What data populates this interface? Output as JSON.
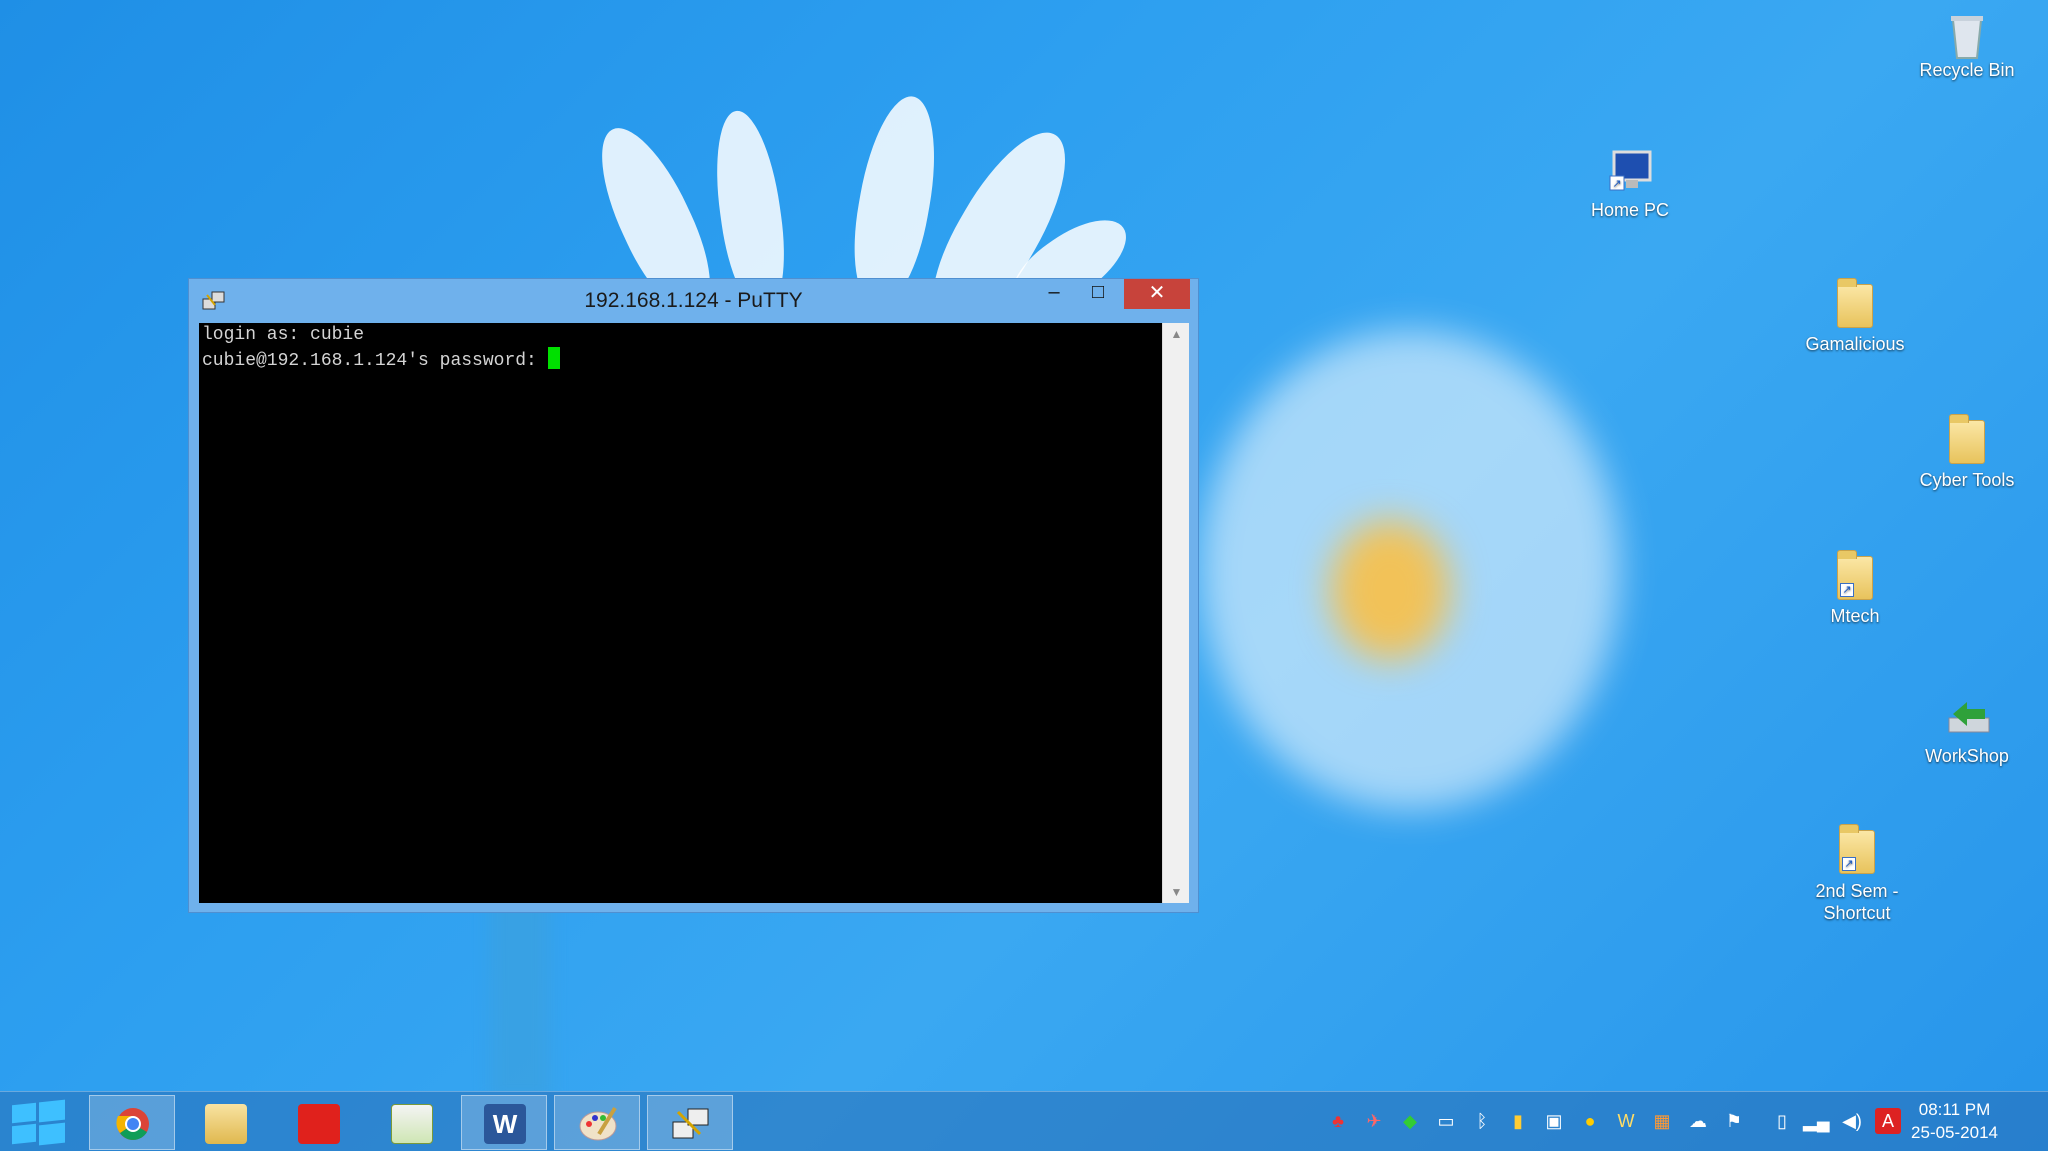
{
  "desktop": {
    "icons": [
      {
        "label": "Recycle Bin",
        "icon": "recycle-bin-icon"
      },
      {
        "label": "Home PC",
        "icon": "computer-shortcut-icon"
      },
      {
        "label": "Gamalicious",
        "icon": "folder-icon"
      },
      {
        "label": "Cyber Tools",
        "icon": "folder-icon"
      },
      {
        "label": "Mtech",
        "icon": "folder-shortcut-icon"
      },
      {
        "label": "WorkShop",
        "icon": "workshop-icon"
      },
      {
        "label": "2nd Sem - Shortcut",
        "icon": "folder-shortcut-icon"
      }
    ]
  },
  "putty": {
    "title": "192.168.1.124 - PuTTY",
    "controls": {
      "minimize": "–",
      "maximize": "□",
      "close": "✕"
    },
    "terminal": {
      "line1": "login as: cubie",
      "line2": "cubie@192.168.1.124's password: "
    }
  },
  "taskbar": {
    "items": [
      {
        "name": "chrome",
        "icon": "chrome-icon",
        "running": true
      },
      {
        "name": "file-explorer",
        "icon": "file-explorer-icon",
        "running": false
      },
      {
        "name": "red-app",
        "icon": "red-tool-icon",
        "running": false
      },
      {
        "name": "notepad",
        "icon": "notepad-icon",
        "running": false
      },
      {
        "name": "word",
        "icon": "word-icon",
        "running": true
      },
      {
        "name": "paint",
        "icon": "paint-icon",
        "running": true
      },
      {
        "name": "putty",
        "icon": "putty-icon",
        "running": true
      }
    ],
    "clock": {
      "time": "08:11 PM",
      "date": "25-05-2014"
    }
  },
  "colors": {
    "terminal_bg": "#000000",
    "cursor": "#00e000",
    "close_button": "#c7433b",
    "titlebar": "#6fb1ec"
  }
}
